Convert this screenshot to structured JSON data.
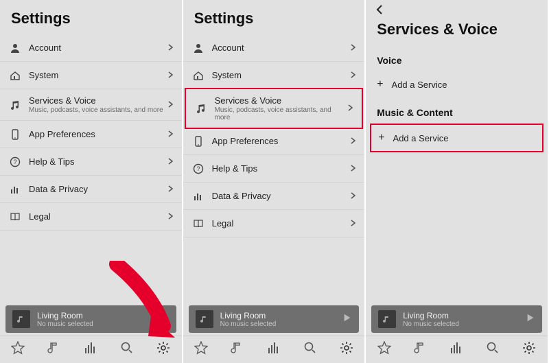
{
  "panes": [
    {
      "title": "Settings",
      "rows": [
        {
          "id": "account",
          "label": "Account"
        },
        {
          "id": "system",
          "label": "System"
        },
        {
          "id": "services",
          "label": "Services & Voice",
          "sub": "Music, podcasts, voice assistants, and more"
        },
        {
          "id": "appprefs",
          "label": "App Preferences"
        },
        {
          "id": "help",
          "label": "Help & Tips"
        },
        {
          "id": "privacy",
          "label": "Data & Privacy"
        },
        {
          "id": "legal",
          "label": "Legal"
        }
      ],
      "nowplaying": {
        "room": "Living Room",
        "status": "No music selected"
      }
    },
    {
      "title": "Settings",
      "rows": [
        {
          "id": "account",
          "label": "Account"
        },
        {
          "id": "system",
          "label": "System"
        },
        {
          "id": "services",
          "label": "Services & Voice",
          "sub": "Music, podcasts, voice assistants, and more",
          "highlight": true
        },
        {
          "id": "appprefs",
          "label": "App Preferences"
        },
        {
          "id": "help",
          "label": "Help & Tips"
        },
        {
          "id": "privacy",
          "label": "Data & Privacy"
        },
        {
          "id": "legal",
          "label": "Legal"
        }
      ],
      "nowplaying": {
        "room": "Living Room",
        "status": "No music selected"
      }
    },
    {
      "title": "Services & Voice",
      "sections": [
        {
          "header": "Voice",
          "add": "Add a Service",
          "highlight": false
        },
        {
          "header": "Music & Content",
          "add": "Add a Service",
          "highlight": true
        }
      ],
      "nowplaying": {
        "room": "Living Room",
        "status": "No music selected"
      }
    }
  ]
}
